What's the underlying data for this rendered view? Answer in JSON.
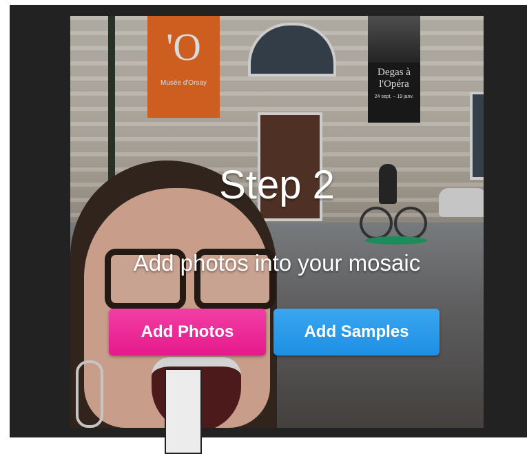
{
  "step": {
    "title": "Step 2",
    "subtitle": "Add photos into your mosaic"
  },
  "buttons": {
    "add_photos": "Add Photos",
    "add_samples": "Add Samples"
  },
  "background_photo": {
    "banner_orange_big": "'O",
    "banner_orange_small": "Musée d'Orsay",
    "banner_dark_title": "Degas à l'Opéra",
    "banner_dark_dates": "24 sept. – 19 janv."
  },
  "colors": {
    "add_photos_button": "#e6198c",
    "add_samples_button": "#1d8fe3",
    "frame_background": "#222222"
  }
}
